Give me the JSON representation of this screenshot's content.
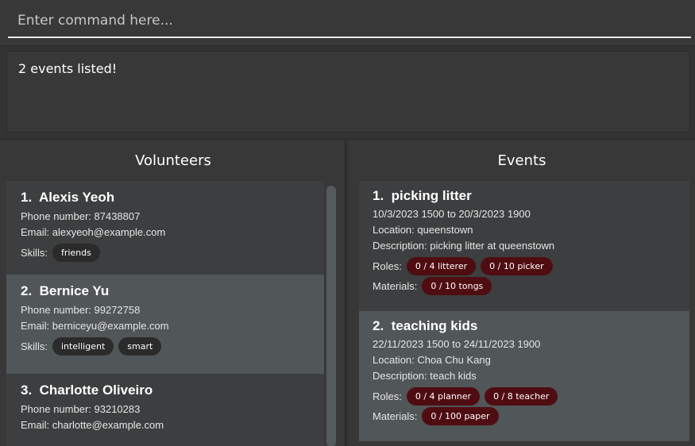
{
  "command": {
    "placeholder": "Enter command here..."
  },
  "result": {
    "text": "2 events listed!"
  },
  "volunteers": {
    "title": "Volunteers",
    "items": [
      {
        "index": "1.",
        "name": "Alexis Yeoh",
        "phone": "Phone number: 87438807",
        "email": "Email: alexyeoh@example.com",
        "skills_label": "Skills:",
        "skills": [
          "friends"
        ]
      },
      {
        "index": "2.",
        "name": "Bernice Yu",
        "phone": "Phone number: 99272758",
        "email": "Email: berniceyu@example.com",
        "skills_label": "Skills:",
        "skills": [
          "intelligent",
          "smart"
        ]
      },
      {
        "index": "3.",
        "name": "Charlotte Oliveiro",
        "phone": "Phone number: 93210283",
        "email": "Email: charlotte@example.com"
      }
    ]
  },
  "events": {
    "title": "Events",
    "items": [
      {
        "index": "1.",
        "name": "picking litter",
        "dates": "10/3/2023 1500 to 20/3/2023 1900",
        "location": "Location: queenstown",
        "description": "Description: picking litter at queenstown",
        "roles_label": "Roles:",
        "roles": [
          "0 / 4 litterer",
          "0 / 10 picker"
        ],
        "materials_label": "Materials:",
        "materials": [
          "0 / 10 tongs"
        ]
      },
      {
        "index": "2.",
        "name": "teaching kids",
        "dates": "22/11/2023 1500 to 24/11/2023 1900",
        "location": "Location: Choa Chu Kang",
        "description": "Description: teach kids",
        "roles_label": "Roles:",
        "roles": [
          "0 / 4 planner",
          "0 / 8 teacher"
        ],
        "materials_label": "Materials:",
        "materials": [
          "0 / 100 paper"
        ]
      }
    ]
  },
  "colors": {
    "background": "#333333",
    "card_selected": "#515658",
    "tag_skill": "#2b2b2b",
    "tag_role": "#4f0d12"
  }
}
